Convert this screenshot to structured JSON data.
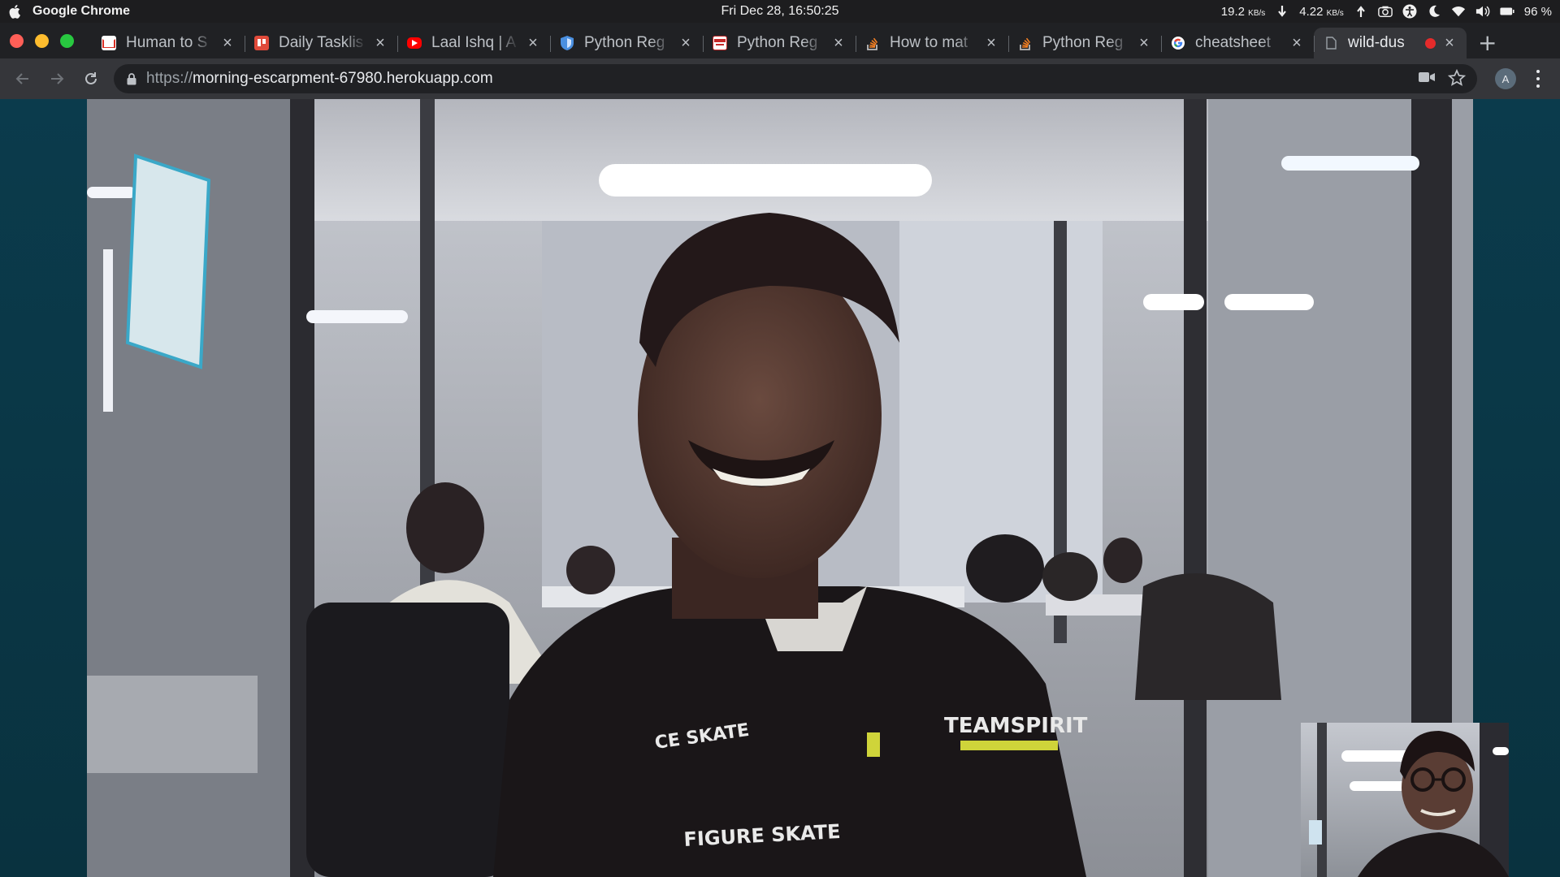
{
  "system_bar": {
    "app_name": "Google Chrome",
    "clock": "Fri Dec 28, 16:50:25",
    "download_speed": "19.2",
    "download_unit": "KB/s",
    "upload_speed": "4.22",
    "upload_unit": "KB/s",
    "battery": "96 %"
  },
  "tabs": [
    {
      "title": "Human to S",
      "favicon": "gmail-icon",
      "color": "#d93025"
    },
    {
      "title": "Daily Tasklis",
      "favicon": "trello-icon",
      "color": "#e04a3a"
    },
    {
      "title": "Laal Ishq | A",
      "favicon": "youtube-icon",
      "color": "#ff0000"
    },
    {
      "title": "Python Reg",
      "favicon": "shield-icon",
      "color": "#4285f4"
    },
    {
      "title": "Python Reg",
      "favicon": "page-icon",
      "color": "#c62828"
    },
    {
      "title": "How to mat",
      "favicon": "stackoverflow-icon",
      "color": "#f48024"
    },
    {
      "title": "Python Reg",
      "favicon": "stackoverflow-icon",
      "color": "#f48024"
    },
    {
      "title": "cheatsheet",
      "favicon": "google-icon",
      "color": "#4285f4"
    },
    {
      "title": "wild-dus",
      "favicon": "blank-page-icon",
      "color": "#9aa0a6",
      "active": true,
      "recording": true
    }
  ],
  "address_bar": {
    "scheme": "https://",
    "host": "morning-escarpment-67980.herokuapp.com"
  },
  "profile_initial": "A",
  "video_call": {
    "remote_stream": "remote-participant-video",
    "local_stream": "local-preview-video"
  }
}
